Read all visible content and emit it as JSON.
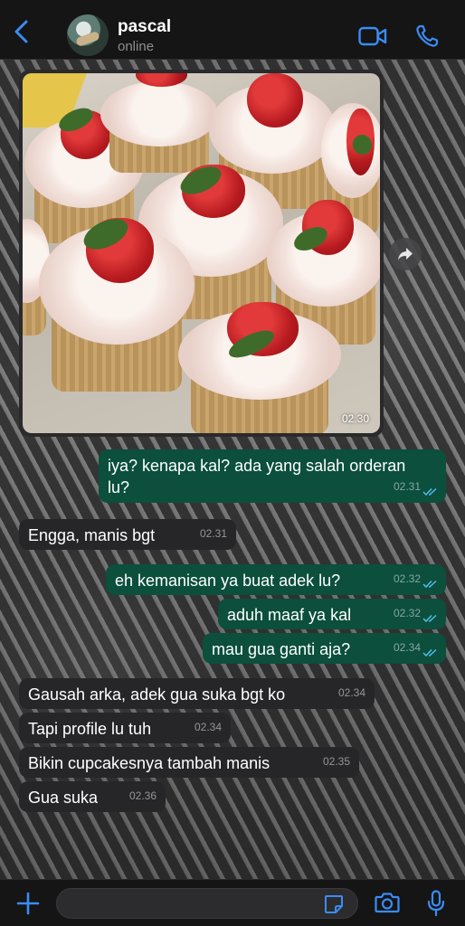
{
  "header": {
    "contact_name": "pascal",
    "status": "online",
    "icons": [
      "back-chevron-icon",
      "video-call-icon",
      "phone-call-icon"
    ]
  },
  "colors": {
    "accent": "#3b8cf5",
    "outgoing_bubble": "#0b4f3c",
    "incoming_bubble": "#262628",
    "read_ticks": "#53bdeb"
  },
  "image_message": {
    "time": "02.30"
  },
  "messages": [
    {
      "dir": "out",
      "text": "iya? kenapa kal? ada yang salah orderan lu?",
      "line1": "iya? kenapa kal? ada yang salah orderan",
      "line2": "lu?",
      "time": "02.31"
    },
    {
      "dir": "in",
      "text": "Engga, manis bgt",
      "time": "02.31"
    },
    {
      "dir": "out",
      "text": "eh kemanisan ya buat adek lu?",
      "time": "02.32"
    },
    {
      "dir": "out",
      "text": "aduh maaf ya kal",
      "time": "02.32"
    },
    {
      "dir": "out",
      "text": "mau gua ganti aja?",
      "time": "02.34"
    },
    {
      "dir": "in",
      "text": "Gausah arka, adek gua suka bgt ko",
      "time": "02.34"
    },
    {
      "dir": "in",
      "text": "Tapi profile lu tuh",
      "time": "02.34"
    },
    {
      "dir": "in",
      "text": "Bikin cupcakesnya tambah manis",
      "time": "02.35"
    },
    {
      "dir": "in",
      "text": "Gua suka",
      "time": "02.36"
    }
  ],
  "composer": {
    "placeholder": "",
    "icons": [
      "plus-icon",
      "sticker-icon",
      "camera-icon",
      "microphone-icon"
    ]
  }
}
